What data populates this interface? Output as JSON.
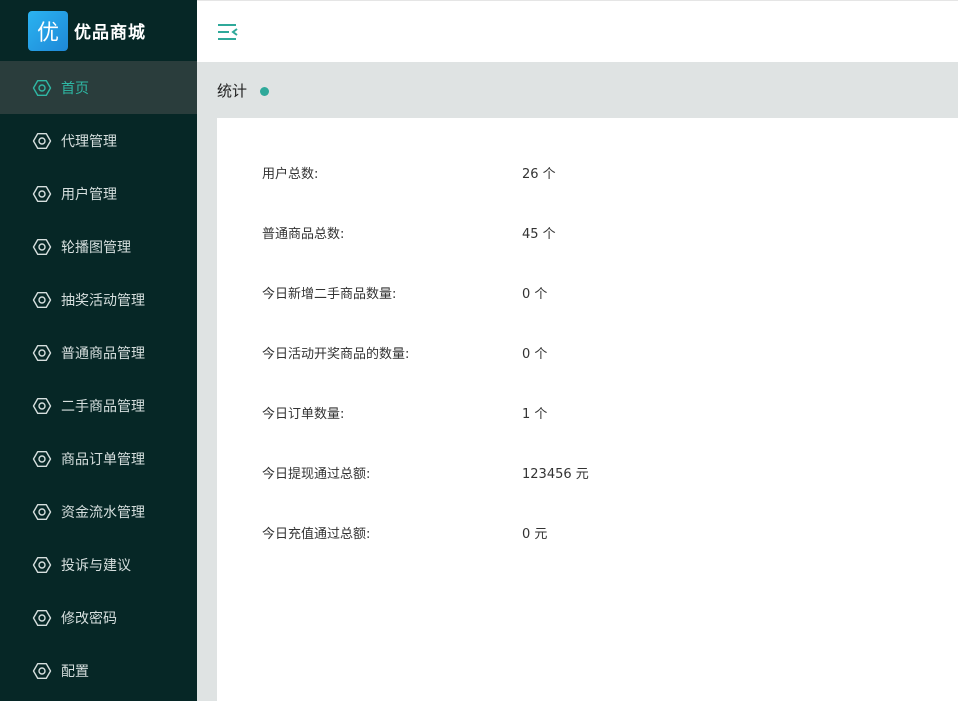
{
  "app": {
    "logo_char": "优",
    "title": "优品商城"
  },
  "sidebar": {
    "items": [
      {
        "label": "首页",
        "icon": "gear-icon",
        "active": true
      },
      {
        "label": "代理管理",
        "icon": "gear-icon"
      },
      {
        "label": "用户管理",
        "icon": "gear-icon"
      },
      {
        "label": "轮播图管理",
        "icon": "gear-icon"
      },
      {
        "label": "抽奖活动管理",
        "icon": "gear-icon"
      },
      {
        "label": "普通商品管理",
        "icon": "gear-icon"
      },
      {
        "label": "二手商品管理",
        "icon": "gear-icon"
      },
      {
        "label": "商品订单管理",
        "icon": "gear-icon"
      },
      {
        "label": "资金流水管理",
        "icon": "gear-icon"
      },
      {
        "label": "投诉与建议",
        "icon": "gear-icon"
      },
      {
        "label": "修改密码",
        "icon": "gear-icon"
      },
      {
        "label": "配置",
        "icon": "gear-icon"
      }
    ]
  },
  "topbar": {
    "toggle_icon": "menu-fold-icon"
  },
  "tab": {
    "title": "统计"
  },
  "stats": [
    {
      "label": "用户总数:",
      "value": "26 个"
    },
    {
      "label": "普通商品总数:",
      "value": "45 个"
    },
    {
      "label": "今日新增二手商品数量:",
      "value": "0 个"
    },
    {
      "label": "今日活动开奖商品的数量:",
      "value": "0 个"
    },
    {
      "label": "今日订单数量:",
      "value": "1 个"
    },
    {
      "label": "今日提现通过总额:",
      "value": "123456 元"
    },
    {
      "label": "今日充值通过总额:",
      "value": "0 元"
    }
  ],
  "colors": {
    "sidebar_bg": "#062726",
    "accent": "#2fb8a4",
    "active_item_bg": "#2a3d3c",
    "tab_dot": "#2fa99a"
  }
}
